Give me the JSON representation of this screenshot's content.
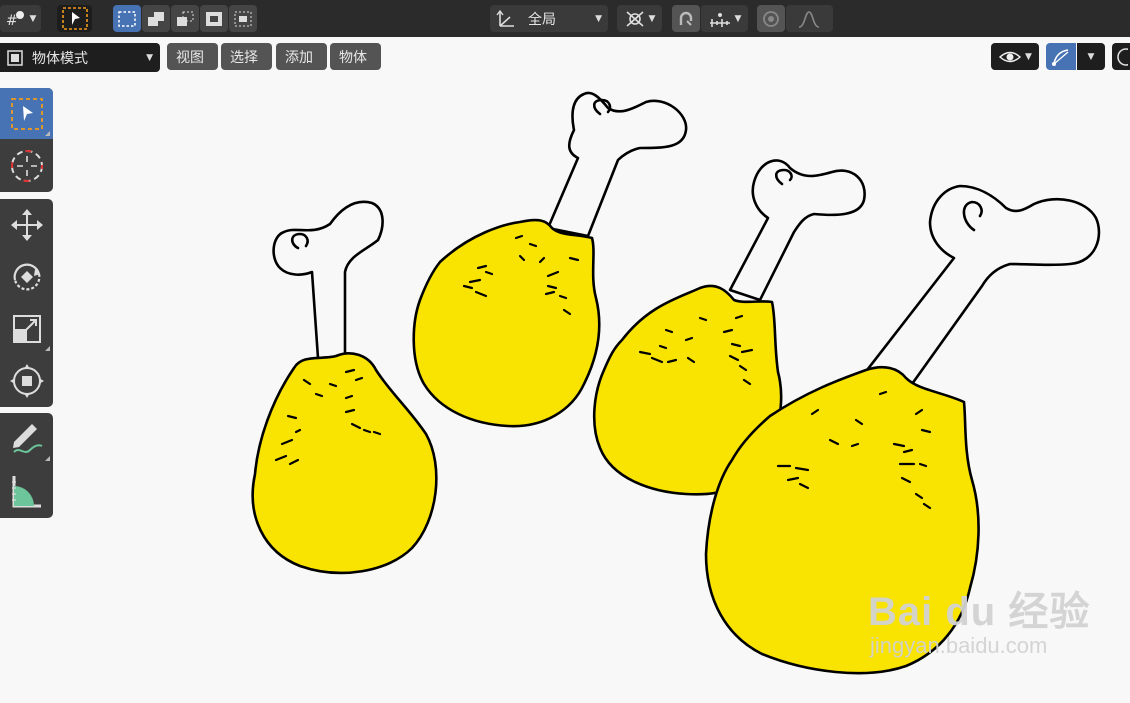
{
  "header": {
    "transform_orientation": "全局",
    "mode": "物体模式",
    "menus": [
      "视图",
      "选择",
      "添加",
      "物体"
    ]
  },
  "toolbar": {
    "tools": [
      "select-box",
      "cursor",
      "move",
      "rotate",
      "scale",
      "transform",
      "annotate",
      "measure"
    ],
    "active": "select-box"
  },
  "watermark": {
    "brand": "Bai du 经验",
    "url": "jingyan.baidu.com"
  },
  "colors": {
    "accent": "#4772b3",
    "drumstick": "#f9e300",
    "background": "#f8f8f8"
  }
}
